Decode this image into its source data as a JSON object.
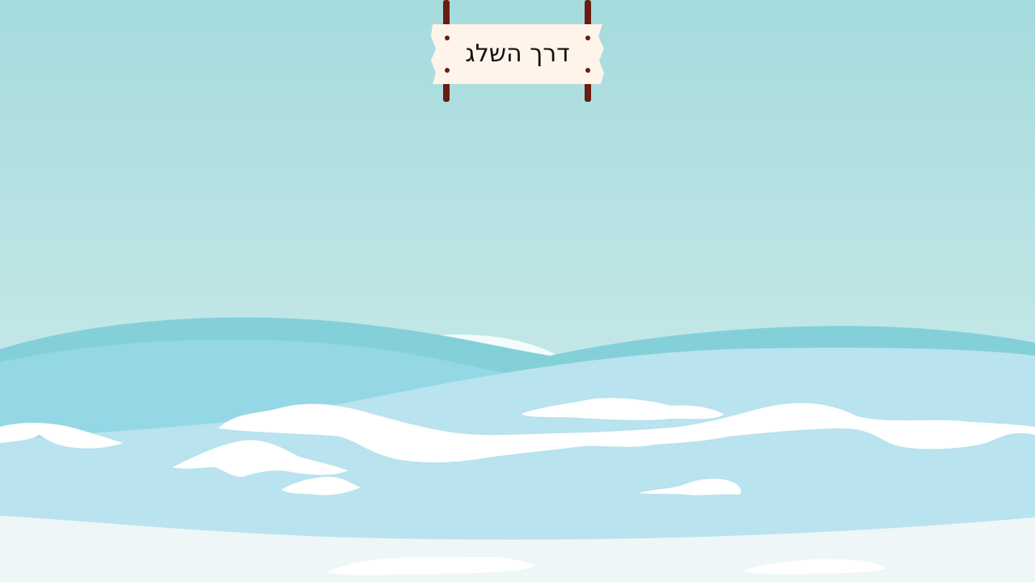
{
  "sign": {
    "title": "דרך השלג"
  },
  "colors": {
    "sky_top": "#a5dbdd",
    "sky_bottom": "#d6eeee",
    "far_hills": "#83d0d9",
    "mid_hills": "#94d8e6",
    "ice_field": "#b9e3ee",
    "snow": "#ffffff",
    "ground": "#eef6f8",
    "sign_board": "#fff4ea",
    "sign_posts": "#6b1c12"
  }
}
